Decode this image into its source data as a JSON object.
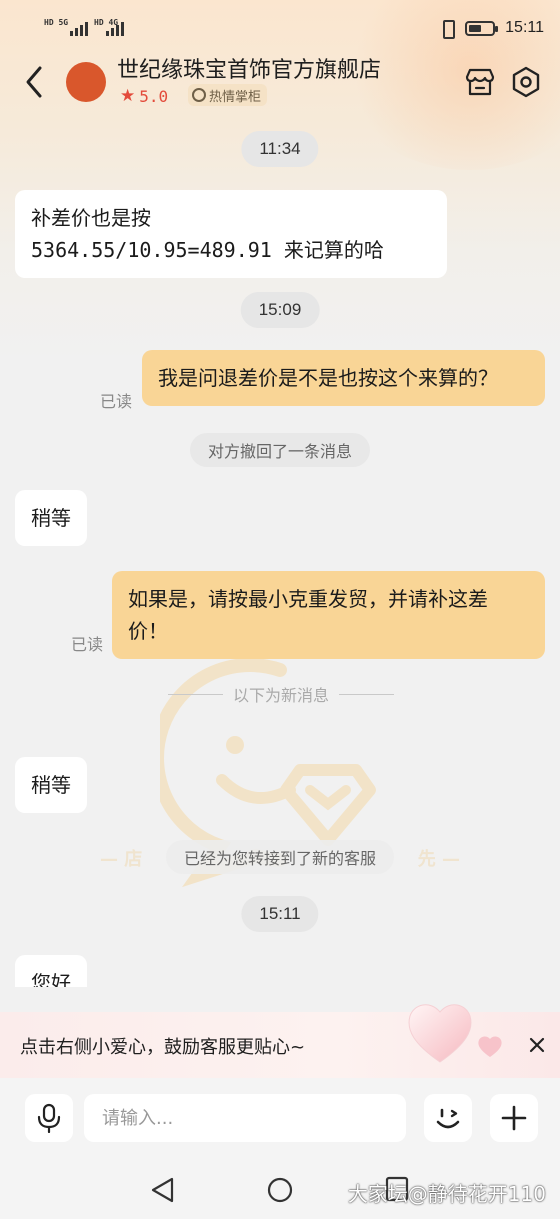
{
  "status_bar": {
    "sim1_labels": "HD 5G",
    "sim2_labels": "HD 4G",
    "time": "15:11",
    "battery_level": 0.55,
    "icons": [
      "vibrate-icon",
      "battery-icon",
      "signal-icon"
    ]
  },
  "header": {
    "store_name": "世纪缘珠宝首饰官方旗舰店",
    "rating": "5.0",
    "rating_star": "★",
    "tag_label": "热情掌柜",
    "icons": [
      "back-chevron-icon",
      "store-icon",
      "settings-hex-icon"
    ]
  },
  "chat": {
    "messages": [
      {
        "type": "time",
        "text": "11:34"
      },
      {
        "type": "left",
        "lines": [
          "补差价也是按",
          "5364.55/10.95=489.91 来记算的哈"
        ]
      },
      {
        "type": "time",
        "text": "15:09"
      },
      {
        "type": "right",
        "text": "我是问退差价是不是也按这个来算的？",
        "status": "已读"
      },
      {
        "type": "system",
        "text": "对方撤回了一条消息"
      },
      {
        "type": "left",
        "text": "稍等"
      },
      {
        "type": "right",
        "lines": [
          "如果是，请按最小克重发贸，并请补这差",
          "价！"
        ],
        "status": "已读"
      },
      {
        "type": "divider",
        "text": "以下为新消息"
      },
      {
        "type": "left",
        "text": "稍等"
      },
      {
        "type": "system",
        "text": "已经为您转接到了新的客服"
      },
      {
        "type": "time",
        "text": "15:11"
      },
      {
        "type": "left",
        "text": "您好"
      }
    ],
    "watermark_left": "店",
    "watermark_right": "先"
  },
  "banner": {
    "text": "点击右侧小爱心，鼓励客服更贴心~",
    "close": "✕"
  },
  "input_bar": {
    "placeholder": "请输入..."
  },
  "forum_watermark": "大家坛@静待花开110",
  "colors": {
    "bubble_right": "#f9d596",
    "bubble_left": "#ffffff",
    "rating_red": "#e34b3b",
    "avatar_orange": "#d9572c"
  }
}
